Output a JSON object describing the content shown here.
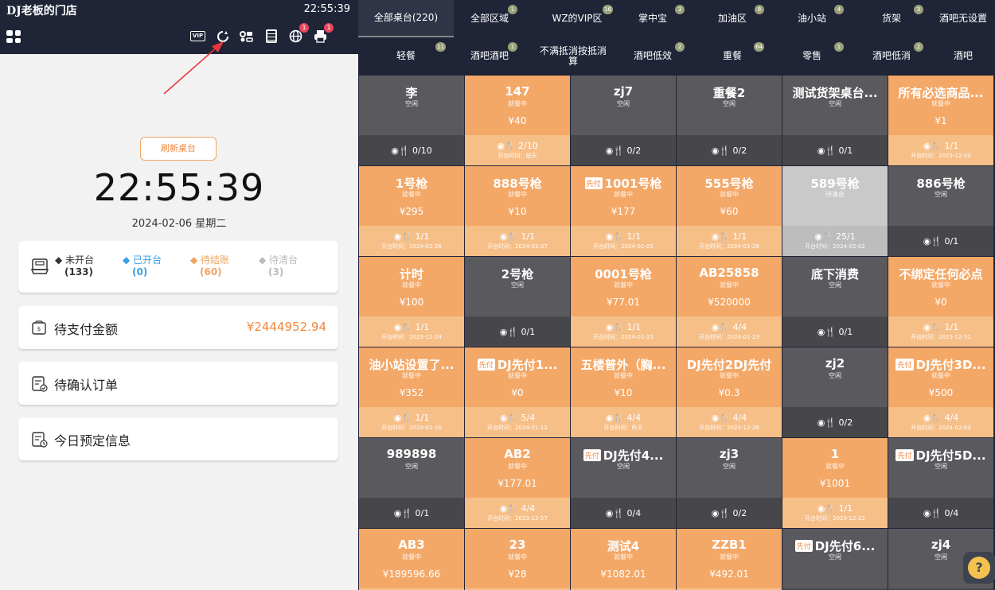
{
  "header": {
    "store_name": "DJ老板的门店",
    "time": "22:55:39"
  },
  "toolbar_icons": [
    {
      "name": "vip-icon",
      "label": "VIP",
      "badge": ""
    },
    {
      "name": "refresh-icon",
      "label": "",
      "badge": ""
    },
    {
      "name": "link-icon",
      "label": "",
      "badge": ""
    },
    {
      "name": "orders-icon",
      "label": "",
      "badge": ""
    },
    {
      "name": "globe-icon",
      "label": "",
      "badge": "1"
    },
    {
      "name": "printer-icon",
      "label": "",
      "badge": "1"
    }
  ],
  "clock": {
    "refresh_label": "刷新桌台",
    "time": "22:55:39",
    "date": "2024-02-06 星期二"
  },
  "status": [
    {
      "label": "◆ 未开台",
      "count": "(133)",
      "color": "#333333"
    },
    {
      "label": "◆ 已开台",
      "count": "(0)",
      "color": "#3a9ee4"
    },
    {
      "label": "◆ 待结账",
      "count": "(60)",
      "color": "#f0a460"
    },
    {
      "label": "◆ 待清台",
      "count": "(3)",
      "color": "#bbbbbb"
    }
  ],
  "pending_payment": {
    "label": "待支付金额",
    "amount": "¥2444952.94"
  },
  "pending_confirm": {
    "label": "待确认订单"
  },
  "today_reservation": {
    "label": "今日预定信息"
  },
  "tabs_row1": [
    {
      "label": "全部桌台(220)",
      "badge": "",
      "active": true
    },
    {
      "label": "全部区域",
      "badge": "1"
    },
    {
      "label": "WZ的VIP区",
      "badge": "16"
    },
    {
      "label": "掌中宝",
      "badge": "3"
    },
    {
      "label": "加油区",
      "badge": "8"
    },
    {
      "label": "油小站",
      "badge": "4"
    },
    {
      "label": "货架",
      "badge": "3"
    },
    {
      "label": "酒吧无设置",
      "badge": ""
    }
  ],
  "tabs_row2": [
    {
      "label": "轻餐",
      "badge": "11"
    },
    {
      "label": "酒吧酒吧",
      "badge": "1"
    },
    {
      "label": "不满抵消按抵消算",
      "badge": ""
    },
    {
      "label": "酒吧低效",
      "badge": "2"
    },
    {
      "label": "重餐",
      "badge": "64"
    },
    {
      "label": "零售",
      "badge": "1"
    },
    {
      "label": "酒吧低消",
      "badge": "2"
    },
    {
      "label": "酒吧",
      "badge": ""
    }
  ],
  "status_colors": {
    "idle": "#5a5a5e",
    "dining": "#f4a867",
    "to_clear": "#c9c9c9",
    "accent": "#f0883e"
  },
  "tables": [
    {
      "name": "李",
      "status": "空闲",
      "state": "idle",
      "amount": "",
      "guests": "0/10",
      "open_time": "",
      "prepay": false
    },
    {
      "name": "147",
      "status": "就餐中",
      "state": "dining",
      "amount": "¥40",
      "guests": "2/10",
      "open_time": "开台时间：前天",
      "prepay": false
    },
    {
      "name": "zj7",
      "status": "空闲",
      "state": "idle",
      "amount": "",
      "guests": "0/2",
      "open_time": "",
      "prepay": false
    },
    {
      "name": "重餐2",
      "status": "空闲",
      "state": "idle",
      "amount": "",
      "guests": "0/2",
      "open_time": "",
      "prepay": false
    },
    {
      "name": "测试货架桌台...",
      "status": "空闲",
      "state": "idle",
      "amount": "",
      "guests": "0/1",
      "open_time": "",
      "prepay": false
    },
    {
      "name": "所有必选商品...",
      "status": "就餐中",
      "state": "dining",
      "amount": "¥1",
      "guests": "1/1",
      "open_time": "开台时间：2023-12-20",
      "prepay": false
    },
    {
      "name": "1号枪",
      "status": "就餐中",
      "state": "dining",
      "amount": "¥295",
      "guests": "1/1",
      "open_time": "开台时间：2024-01-26",
      "prepay": false
    },
    {
      "name": "888号枪",
      "status": "就餐中",
      "state": "dining",
      "amount": "¥10",
      "guests": "1/1",
      "open_time": "开台时间：2024-01-07",
      "prepay": false
    },
    {
      "name": "1001号枪",
      "status": "就餐中",
      "state": "dining",
      "amount": "¥177",
      "guests": "1/1",
      "open_time": "开台时间：2024-01-05",
      "prepay": true
    },
    {
      "name": "555号枪",
      "status": "就餐中",
      "state": "dining",
      "amount": "¥60",
      "guests": "1/1",
      "open_time": "开台时间：2024-01-28",
      "prepay": false
    },
    {
      "name": "589号枪",
      "status": "待清台",
      "state": "clear",
      "amount": "",
      "guests": "25/1",
      "open_time": "开台时间：2024-02-02",
      "prepay": false
    },
    {
      "name": "886号枪",
      "status": "空闲",
      "state": "idle",
      "amount": "",
      "guests": "0/1",
      "open_time": "",
      "prepay": false
    },
    {
      "name": "计时",
      "status": "就餐中",
      "state": "dining",
      "amount": "¥100",
      "guests": "1/1",
      "open_time": "开台时间：2023-12-24",
      "prepay": false
    },
    {
      "name": "2号枪",
      "status": "空闲",
      "state": "idle",
      "amount": "",
      "guests": "0/1",
      "open_time": "",
      "prepay": false
    },
    {
      "name": "0001号枪",
      "status": "就餐中",
      "state": "dining",
      "amount": "¥77.01",
      "guests": "1/1",
      "open_time": "开台时间：2024-01-23",
      "prepay": false
    },
    {
      "name": "AB25858",
      "status": "就餐中",
      "state": "dining",
      "amount": "¥520000",
      "guests": "4/4",
      "open_time": "开台时间：2024-01-23",
      "prepay": false
    },
    {
      "name": "底下消费",
      "status": "空闲",
      "state": "idle",
      "amount": "",
      "guests": "0/1",
      "open_time": "",
      "prepay": false
    },
    {
      "name": "不绑定任何必点",
      "status": "就餐中",
      "state": "dining",
      "amount": "¥0",
      "guests": "1/1",
      "open_time": "开台时间：2023-12-31",
      "prepay": false
    },
    {
      "name": "油小站设置了...",
      "status": "就餐中",
      "state": "dining",
      "amount": "¥352",
      "guests": "1/1",
      "open_time": "开台时间：2024-01-16",
      "prepay": false
    },
    {
      "name": "DJ先付1...",
      "status": "就餐中",
      "state": "dining",
      "amount": "¥0",
      "guests": "5/4",
      "open_time": "开台时间：2024-01-12",
      "prepay": true
    },
    {
      "name": "五楼普外（胸...",
      "status": "就餐中",
      "state": "dining",
      "amount": "¥10",
      "guests": "4/4",
      "open_time": "开台时间：昨天",
      "prepay": false
    },
    {
      "name": "DJ先付2DJ先付",
      "status": "就餐中",
      "state": "dining",
      "amount": "¥0.3",
      "guests": "4/4",
      "open_time": "开台时间：2023-12-28",
      "prepay": false
    },
    {
      "name": "zj2",
      "status": "空闲",
      "state": "idle",
      "amount": "",
      "guests": "0/2",
      "open_time": "",
      "prepay": false
    },
    {
      "name": "DJ先付3D...",
      "status": "就餐中",
      "state": "dining",
      "amount": "¥500",
      "guests": "4/4",
      "open_time": "开台时间：2024-02-03",
      "prepay": true
    },
    {
      "name": "989898",
      "status": "空闲",
      "state": "idle",
      "amount": "",
      "guests": "0/1",
      "open_time": "",
      "prepay": false
    },
    {
      "name": "AB2",
      "status": "就餐中",
      "state": "dining",
      "amount": "¥177.01",
      "guests": "4/4",
      "open_time": "开台时间：2023-12-27",
      "prepay": false
    },
    {
      "name": "DJ先付4...",
      "status": "空闲",
      "state": "idle",
      "amount": "",
      "guests": "0/4",
      "open_time": "",
      "prepay": true
    },
    {
      "name": "zj3",
      "status": "空闲",
      "state": "idle",
      "amount": "",
      "guests": "0/2",
      "open_time": "",
      "prepay": false
    },
    {
      "name": "1",
      "status": "就餐中",
      "state": "dining",
      "amount": "¥1001",
      "guests": "1/1",
      "open_time": "开台时间：2023-12-22",
      "prepay": false
    },
    {
      "name": "DJ先付5D...",
      "status": "空闲",
      "state": "idle",
      "amount": "",
      "guests": "0/4",
      "open_time": "",
      "prepay": true
    },
    {
      "name": "AB3",
      "status": "就餐中",
      "state": "dining",
      "amount": "¥189596.66",
      "guests": "",
      "open_time": "",
      "prepay": false
    },
    {
      "name": "23",
      "status": "就餐中",
      "state": "dining",
      "amount": "¥28",
      "guests": "",
      "open_time": "",
      "prepay": false
    },
    {
      "name": "测试4",
      "status": "就餐中",
      "state": "dining",
      "amount": "¥1082.01",
      "guests": "",
      "open_time": "",
      "prepay": false
    },
    {
      "name": "ZZB1",
      "status": "就餐中",
      "state": "dining",
      "amount": "¥492.01",
      "guests": "",
      "open_time": "",
      "prepay": false
    },
    {
      "name": "DJ先付6...",
      "status": "空闲",
      "state": "idle",
      "amount": "",
      "guests": "",
      "open_time": "",
      "prepay": true
    },
    {
      "name": "zj4",
      "status": "空闲",
      "state": "idle",
      "amount": "",
      "guests": "",
      "open_time": "",
      "prepay": false
    }
  ],
  "labels": {
    "prepay_tag": "先付",
    "guest_icon": "◉🍴"
  }
}
